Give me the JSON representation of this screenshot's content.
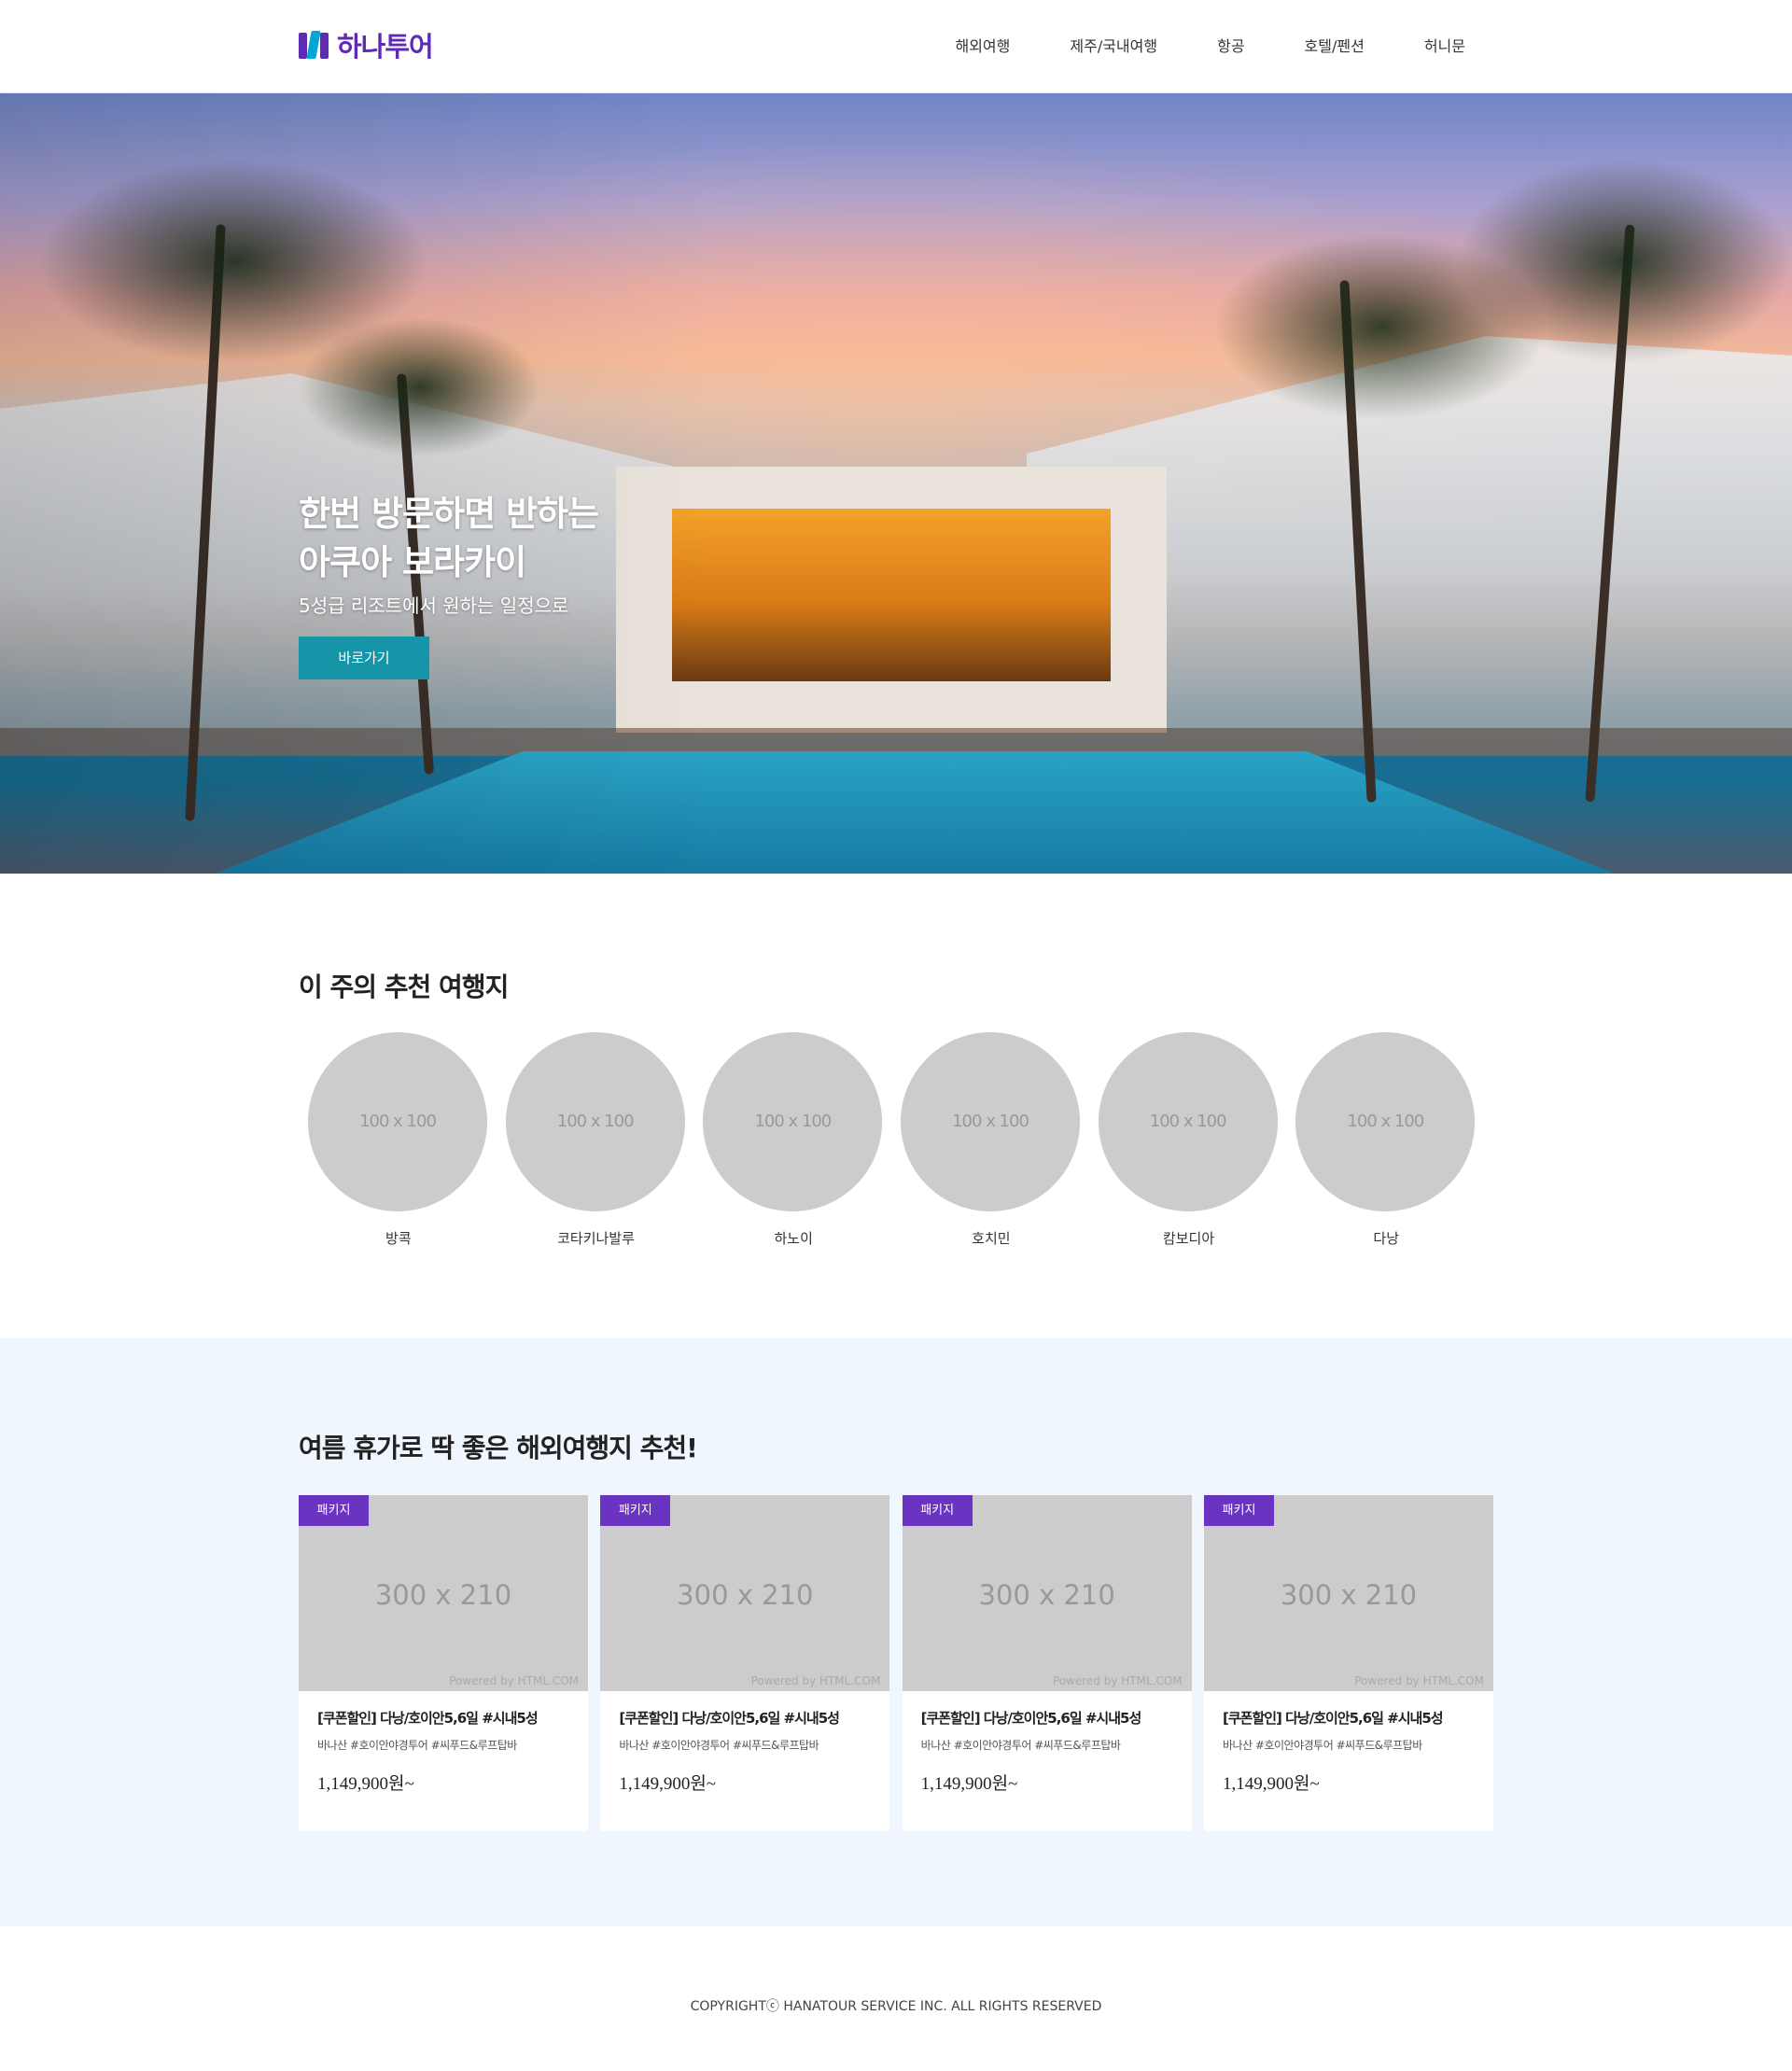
{
  "header": {
    "logo_text": "하나투어",
    "nav": [
      "해외여행",
      "제주/국내여행",
      "항공",
      "호텔/펜션",
      "허니문"
    ]
  },
  "hero": {
    "title_line1": "한번 방문하면 반하는",
    "title_line2": "아쿠아 보라카이",
    "subtitle": "5성급 리조트에서 원하는 일정으로",
    "button": "바로가기"
  },
  "recommend": {
    "title": "이 주의 추천 여행지",
    "items": [
      {
        "placeholder": "100 x 100",
        "label": "방콕"
      },
      {
        "placeholder": "100 x 100",
        "label": "코타키나발루"
      },
      {
        "placeholder": "100 x 100",
        "label": "하노이"
      },
      {
        "placeholder": "100 x 100",
        "label": "호치민"
      },
      {
        "placeholder": "100 x 100",
        "label": "캄보디아"
      },
      {
        "placeholder": "100 x 100",
        "label": "다낭"
      }
    ]
  },
  "packages": {
    "title": "여름 휴가로 딱 좋은 해외여행지 추천!",
    "cards": [
      {
        "tag": "패키지",
        "placeholder": "300 x 210",
        "powered": "Powered by HTML.COM",
        "title": "[쿠폰할인] 다낭/호이안5,6일 #시내5성",
        "desc": "바나산 #호이안야경투어 #씨푸드&루프탑바",
        "price": "1,149,900원~"
      },
      {
        "tag": "패키지",
        "placeholder": "300 x 210",
        "powered": "Powered by HTML.COM",
        "title": "[쿠폰할인] 다낭/호이안5,6일 #시내5성",
        "desc": "바나산 #호이안야경투어 #씨푸드&루프탑바",
        "price": "1,149,900원~"
      },
      {
        "tag": "패키지",
        "placeholder": "300 x 210",
        "powered": "Powered by HTML.COM",
        "title": "[쿠폰할인] 다낭/호이안5,6일 #시내5성",
        "desc": "바나산 #호이안야경투어 #씨푸드&루프탑바",
        "price": "1,149,900원~"
      },
      {
        "tag": "패키지",
        "placeholder": "300 x 210",
        "powered": "Powered by HTML.COM",
        "title": "[쿠폰할인] 다낭/호이안5,6일 #시내5성",
        "desc": "바나산 #호이안야경투어 #씨푸드&루프탑바",
        "price": "1,149,900원~"
      }
    ]
  },
  "footer": {
    "copyright": "COPYRIGHTⓒ HANATOUR SERVICE INC. ALL RIGHTS RESERVED"
  },
  "colors": {
    "brand_purple": "#5e2bb5",
    "brand_cyan": "#00a6d6",
    "button_teal": "#1695a8",
    "tag_purple": "#6a33c2",
    "section_bg": "#eff6fd",
    "placeholder_gray": "#cccccc"
  }
}
